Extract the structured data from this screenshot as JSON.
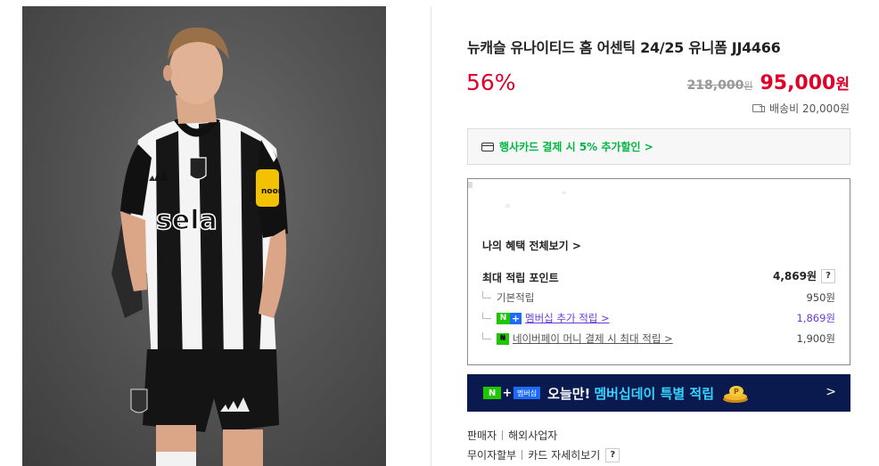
{
  "product": {
    "title": "뉴캐슬 유나이티드 홈 어센틱 24/25 유니폼 JJ4466",
    "discount": "56%",
    "old_price": "218,000",
    "old_price_unit": "원",
    "new_price": "95,000",
    "new_price_unit": "원",
    "shipping": "배송비 20,000원",
    "jersey_text": "sela",
    "sleeve_badge": "noon"
  },
  "card_promo": {
    "label": "행사카드 결제 시 5% 추가할인 >",
    "icon": "credit-card-icon"
  },
  "benefits": {
    "view_all": "나의 혜택 전체보기 >",
    "max_points_label": "최대 적립 포인트",
    "max_points_value": "4,869원",
    "help": "?",
    "rows": [
      {
        "label": "기본적립",
        "value": "950원"
      },
      {
        "badge": "N",
        "label": "멤버십 추가 적립 >",
        "value": "1,869원"
      },
      {
        "label": "네이버페이 머니 결제 시 최대 적립 >",
        "value": "1,900원"
      }
    ]
  },
  "banner": {
    "n_badge": "N",
    "plus": "+",
    "tag": "멤버십",
    "text1": "오늘만!",
    "text2": "멤버십데이 특별 적립",
    "chevron": ">"
  },
  "footer": {
    "seller": "판매자",
    "seller_type": "해외사업자",
    "installment": "무이자할부",
    "card_detail": "카드 자세히보기",
    "help": "?"
  },
  "colors": {
    "sale_red": "#e0002a",
    "naver_green": "#1ec800",
    "banner_navy": "#0a1a4f",
    "membership_purple": "#6a3cd6"
  }
}
